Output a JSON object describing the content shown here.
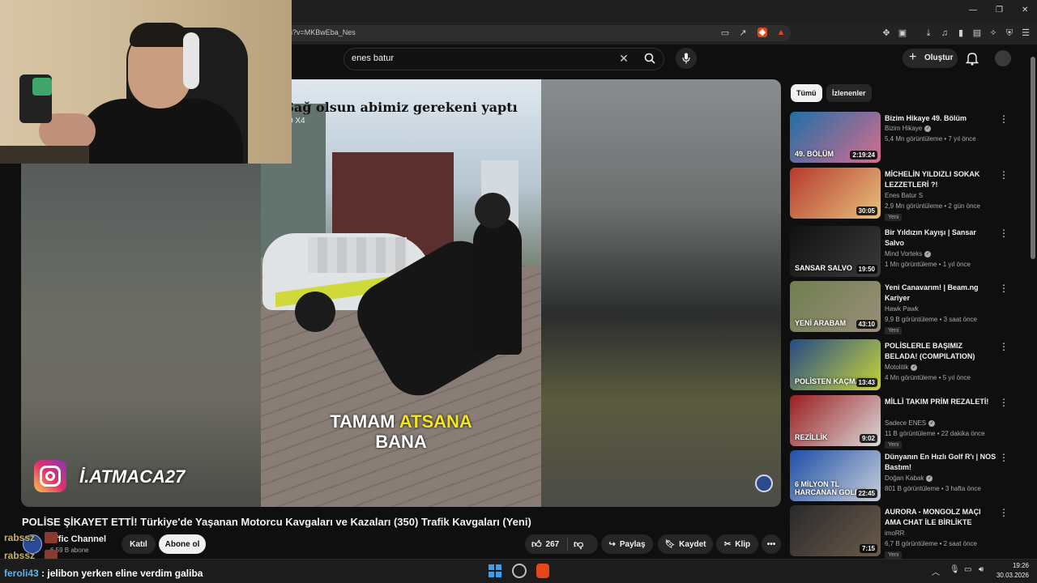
{
  "browser": {
    "url_visible": "h?v=MKBwEba_Nes",
    "window_controls": [
      "—",
      "❐",
      "✕"
    ]
  },
  "header": {
    "search_value": "enes batur",
    "create_label": "Oluştur"
  },
  "player": {
    "caption_top": "Sağ olsun abimiz gerekeni yaptı",
    "caption_bottom_1": "TAMAM",
    "caption_bottom_2": "ATSANA",
    "caption_bottom_3": "BANA",
    "camera_label": "nsta360 X4",
    "instagram_handle": "İ.ATMACA27"
  },
  "video": {
    "title": "POLİSE ŞİKAYET ETTİ! Türkiye'de Yaşanan Motorcu Kavgaları ve Kazaları (350) Trafik Kavgaları (Yeni)",
    "channel": "affic Channel",
    "subscribers": "6,59 B abone",
    "join_label": "Katıl",
    "subscribe_label": "Abone ol",
    "likes": "267",
    "share_label": "Paylaş",
    "save_label": "Kaydet",
    "clip_label": "Klip"
  },
  "sidebar": {
    "chips": [
      "Tümü",
      "İzlenenler"
    ],
    "items": [
      {
        "title": "Bizim Hikaye 49. Bölüm",
        "channel": "Bizim Hikaye",
        "verified": true,
        "meta": "5,4 Mn görüntüleme • 7 yıl önce",
        "duration": "2:19:24",
        "thumb_text": "49. BÖLÜM",
        "new": "",
        "colors": [
          "#1f6fa8",
          "#d86c8e"
        ]
      },
      {
        "title": "MİCHELİN YILDIZLI SOKAK LEZZETLERİ ?!",
        "channel": "Enes Batur S",
        "verified": false,
        "meta": "2,9 Mn görüntüleme • 2 gün önce",
        "duration": "30:05",
        "thumb_text": "",
        "new": "Yeni",
        "colors": [
          "#b8392f",
          "#e5c27c"
        ]
      },
      {
        "title": "Bir Yıldızın Kayışı | Sansar Salvo",
        "channel": "Mind Vorteks",
        "verified": true,
        "meta": "1 Mn görüntüleme • 1 yıl önce",
        "duration": "19:50",
        "thumb_text": "SANSAR SALVO",
        "new": "",
        "colors": [
          "#111111",
          "#3a3a3a"
        ]
      },
      {
        "title": "Yeni Canavarım! | Beam.ng Kariyer",
        "channel": "Hawk Pawk",
        "verified": false,
        "meta": "9,9 B görüntüleme • 3 saat önce",
        "duration": "43:10",
        "thumb_text": "YENİ ARABAM",
        "new": "Yeni",
        "colors": [
          "#6f7f4e",
          "#9a8e7a"
        ]
      },
      {
        "title": "POLİSLERLE BAŞIMIZ BELADA! (COMPILATION)",
        "channel": "Motolitik",
        "verified": true,
        "meta": "4 Mn görüntüleme • 5 yıl önce",
        "duration": "13:43",
        "thumb_text": "POLİSTEN KAÇMAYIN!!",
        "new": "",
        "colors": [
          "#244a86",
          "#c8d43a"
        ]
      },
      {
        "title": "MİLLİ TAKIM PRİM REZALETİ!",
        "channel": "Sadece ENES",
        "verified": true,
        "meta": "11 B görüntüleme • 22 dakika önce",
        "duration": "9:02",
        "thumb_text": "REZİLLİK",
        "new": "Yeni",
        "colors": [
          "#9b1d20",
          "#d9d9d9"
        ]
      },
      {
        "title": "Dünyanın En Hızlı Golf R'ı | NOS Bastım!",
        "channel": "Doğan Kabak",
        "verified": true,
        "meta": "801 B görüntüleme • 3 hafta önce",
        "duration": "22:45",
        "thumb_text": "6 MİLYON TL HARCANAN GOLF R",
        "new": "",
        "colors": [
          "#1e4fa8",
          "#c7cfd8"
        ]
      },
      {
        "title": "AURORA - MONGOLZ MAÇI AMA CHAT İLE BİRLİKTE",
        "channel": "imoRR",
        "verified": false,
        "meta": "6,7 B görüntüleme • 2 saat önce",
        "duration": "7:15",
        "thumb_text": "",
        "new": "Yeni",
        "colors": [
          "#2a2a2a",
          "#6b5a4c"
        ]
      }
    ]
  },
  "chat": {
    "overlay_names": [
      "rabssz",
      "rabssz"
    ],
    "line_user": "feroli43",
    "line_message": "jelibon yerken eline verdim galiba"
  },
  "taskbar": {
    "time": "19:26",
    "date": "30.03.2026"
  }
}
